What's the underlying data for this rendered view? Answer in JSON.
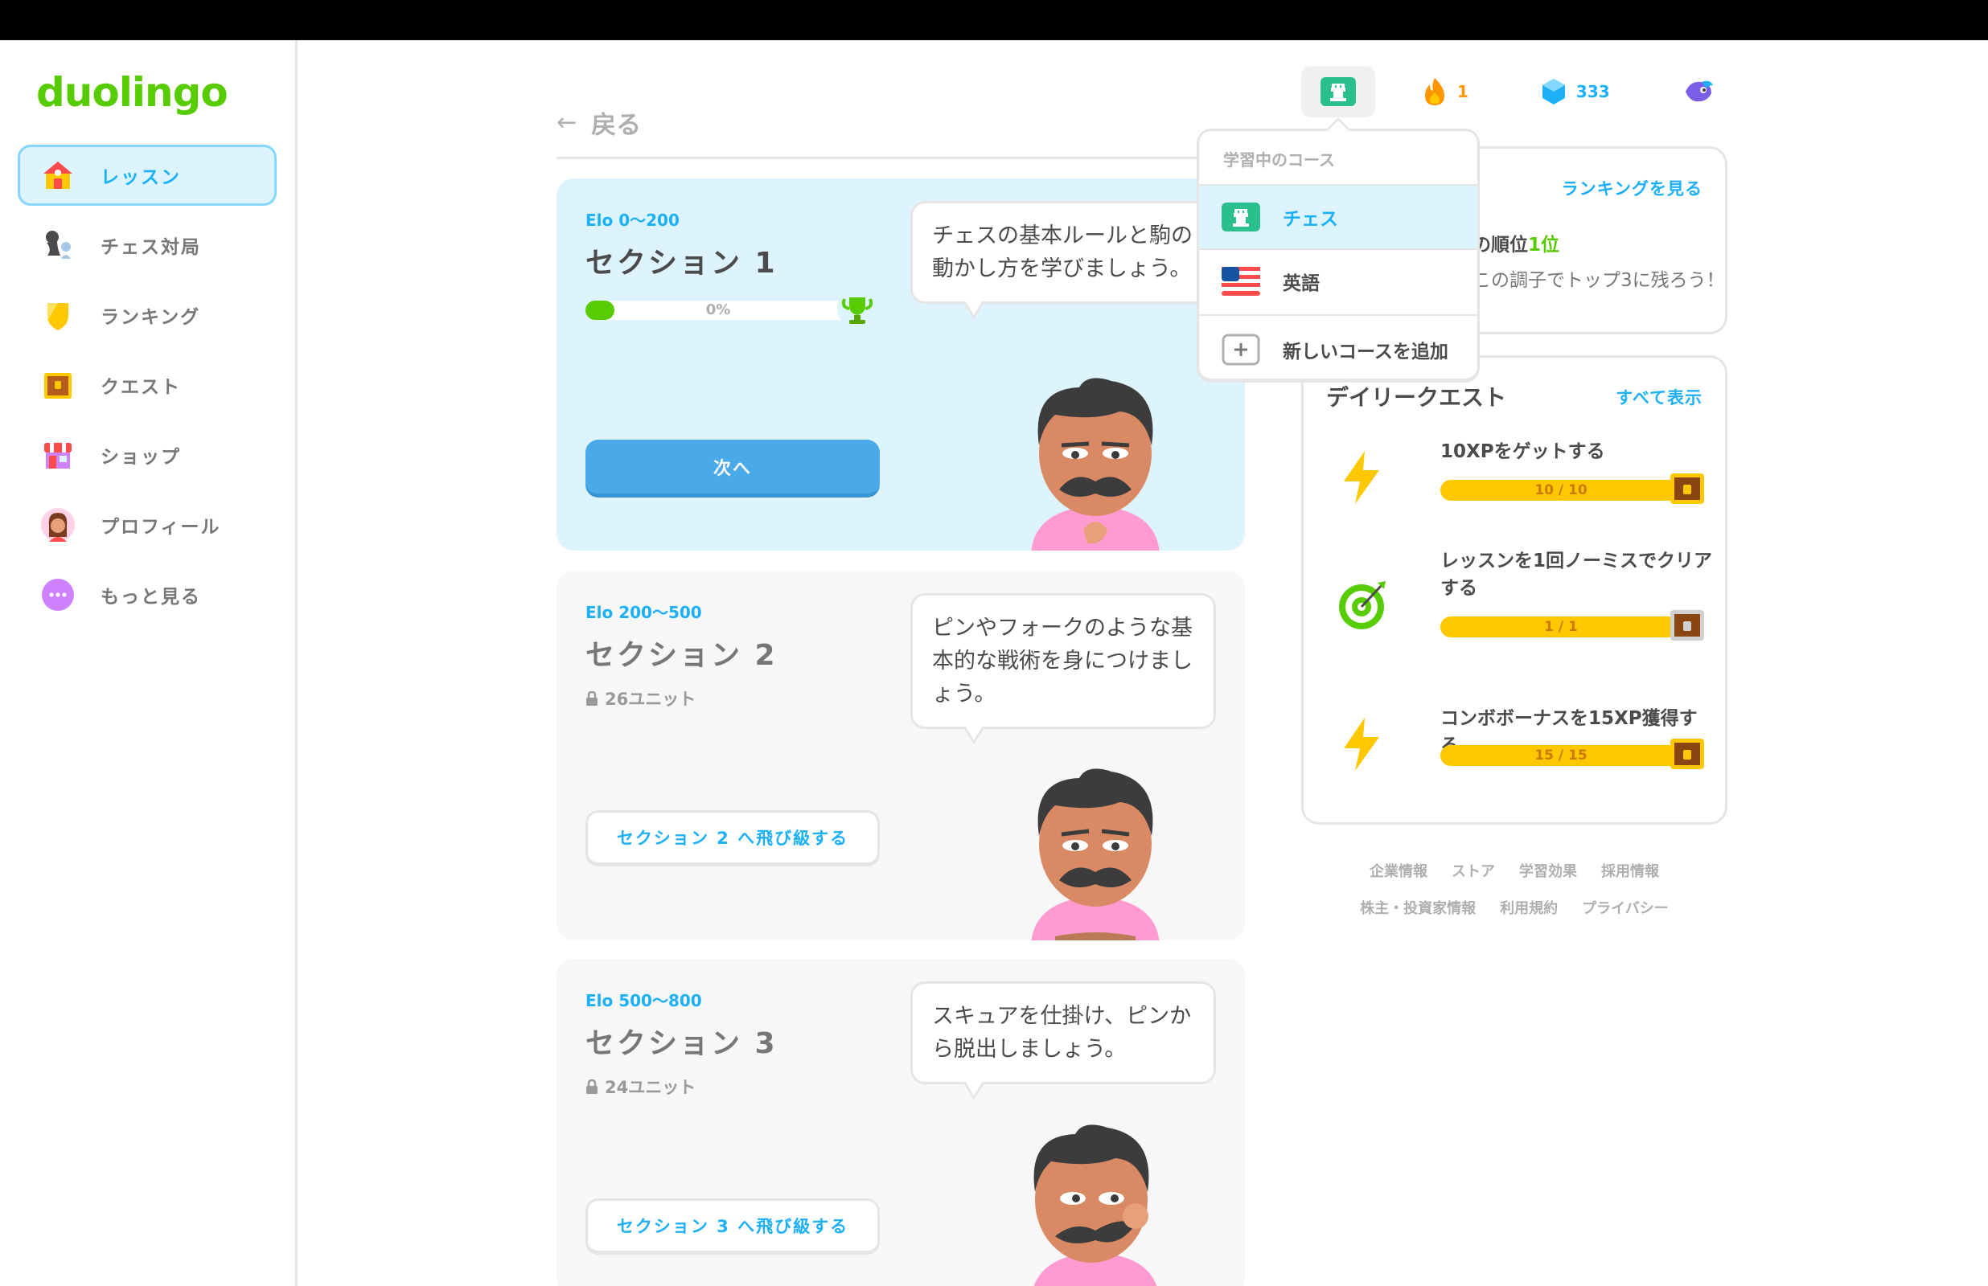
{
  "brand": {
    "logo_text": "duolingo",
    "accent": "#58cc02",
    "link_color": "#1cb0f6"
  },
  "sidebar": {
    "items": [
      {
        "label": "レッスン",
        "icon": "home-icon",
        "active": true
      },
      {
        "label": "チェス対局",
        "icon": "chess-pieces-icon",
        "active": false
      },
      {
        "label": "ランキング",
        "icon": "shield-icon",
        "active": false
      },
      {
        "label": "クエスト",
        "icon": "treasure-chest-icon",
        "active": false
      },
      {
        "label": "ショップ",
        "icon": "shop-icon",
        "active": false
      },
      {
        "label": "プロフィール",
        "icon": "avatar-icon",
        "active": false
      },
      {
        "label": "もっと見る",
        "icon": "more-dots-icon",
        "active": false
      }
    ]
  },
  "header": {
    "back_label": "戻る"
  },
  "sections": [
    {
      "elo": "Elo 0〜200",
      "title": "セクション 1",
      "progress_text": "0%",
      "progress_value": 0,
      "button_label": "次へ",
      "bubble": "チェスの基本ルールと駒の動かし方を学びましょう。"
    },
    {
      "elo": "Elo 200〜500",
      "title": "セクション 2",
      "units": "26ユニット",
      "button_label": "セクション 2 へ飛び級する",
      "bubble": "ピンやフォークのような基本的な戦術を身につけましょう。"
    },
    {
      "elo": "Elo 500〜800",
      "title": "セクション 3",
      "units": "24ユニット",
      "button_label": "セクション 3 へ飛び級する",
      "bubble": "スキュアを仕掛け、ピンから脱出しましょう。"
    }
  ],
  "stats": {
    "streak": "1",
    "gems": "333"
  },
  "dropdown": {
    "header": "学習中のコース",
    "items": [
      {
        "label": "チェス",
        "icon": "chess-rook-icon",
        "selected": true
      },
      {
        "label": "英語",
        "icon": "us-flag-icon",
        "selected": false
      },
      {
        "label": "新しいコースを追加",
        "icon": "plus-icon",
        "selected": false
      }
    ]
  },
  "ranking": {
    "link": "ランキングを見る",
    "rank_prefix": "の順位",
    "rank_value": "1位",
    "subtitle": "この調子でトップ3に残ろう！"
  },
  "daily_quests": {
    "title": "デイリークエスト",
    "view_all": "すべて表示",
    "items": [
      {
        "name": "10XPをゲットする",
        "progress": "10 / 10",
        "icon": "lightning-icon",
        "fraction": 1.0
      },
      {
        "name": "レッスンを1回ノーミスでクリアする",
        "progress": "1 / 1",
        "icon": "target-icon",
        "fraction": 1.0
      },
      {
        "name": "コンボボーナスを15XP獲得する",
        "progress": "15 / 15",
        "icon": "lightning-icon",
        "fraction": 1.0
      }
    ]
  },
  "footer": {
    "row1": [
      "企業情報",
      "ストア",
      "学習効果",
      "採用情報"
    ],
    "row2": [
      "株主・投資家情報",
      "利用規約",
      "プライバシー"
    ]
  }
}
